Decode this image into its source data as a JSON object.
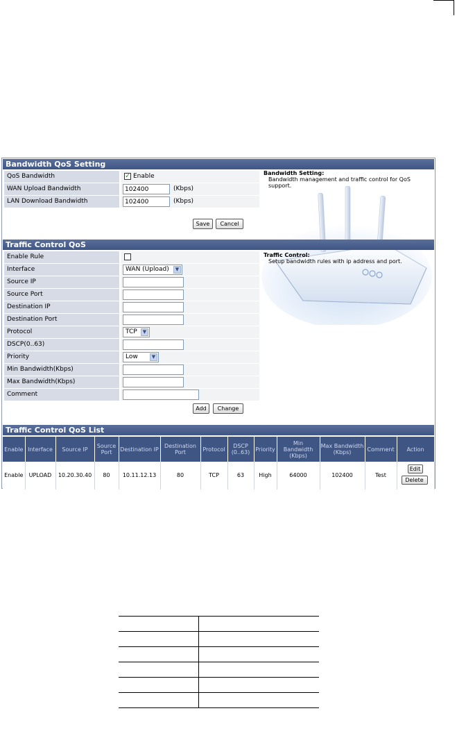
{
  "bandwidth": {
    "section_title": "Bandwidth QoS Setting",
    "qos_label": "QoS Bandwidth",
    "qos_enable_label": "Enable",
    "qos_enabled": true,
    "wan_label": "WAN Upload Bandwidth",
    "wan_value": "102400",
    "wan_unit": "(Kbps)",
    "lan_label": "LAN Download Bandwidth",
    "lan_value": "102400",
    "lan_unit": "(Kbps)",
    "save_label": "Save",
    "cancel_label": "Cancel"
  },
  "help": {
    "bandwidth_title": "Bandwidth Setting:",
    "bandwidth_text": "Bandwidth management and traffic control for QoS support.",
    "traffic_title": "Traffic Control:",
    "traffic_text": "Setup bandwidth rules with ip address and port."
  },
  "traffic": {
    "section_title": "Traffic Control QoS",
    "enable_rule_label": "Enable Rule",
    "enable_rule_checked": false,
    "interface_label": "Interface",
    "interface_value": "WAN (Upload)",
    "source_ip_label": "Source IP",
    "source_ip_value": "",
    "source_port_label": "Source Port",
    "source_port_value": "",
    "dest_ip_label": "Destination IP",
    "dest_ip_value": "",
    "dest_port_label": "Destination Port",
    "dest_port_value": "",
    "protocol_label": "Protocol",
    "protocol_value": "TCP",
    "dscp_label": "DSCP(0..63)",
    "dscp_value": "",
    "priority_label": "Priority",
    "priority_value": "Low",
    "min_bw_label": "Min Bandwidth(Kbps)",
    "min_bw_value": "",
    "max_bw_label": "Max Bandwidth(Kbps)",
    "max_bw_value": "",
    "comment_label": "Comment",
    "comment_value": "",
    "add_label": "Add",
    "change_label": "Change"
  },
  "list": {
    "section_title": "Traffic Control QoS List",
    "headers": [
      "Enable",
      "Interface",
      "Source IP",
      "Source Port",
      "Destination IP",
      "Destination Port",
      "Protocol",
      "DSCP (0..63)",
      "Priority",
      "Min Bandwidth (Kbps)",
      "Max Bandwidth (Kbps)",
      "Comment",
      "Action"
    ],
    "rows": [
      [
        "Enable",
        "UPLOAD",
        "10.20.30.40",
        "80",
        "10.11.12.13",
        "80",
        "TCP",
        "63",
        "High",
        "64000",
        "102400",
        "Test"
      ]
    ],
    "edit_label": "Edit",
    "delete_label": "Delete"
  },
  "colors": {
    "section_bar": "#3f5584",
    "label_cell": "#d7dbe5",
    "value_cell": "#f2f3f5"
  }
}
